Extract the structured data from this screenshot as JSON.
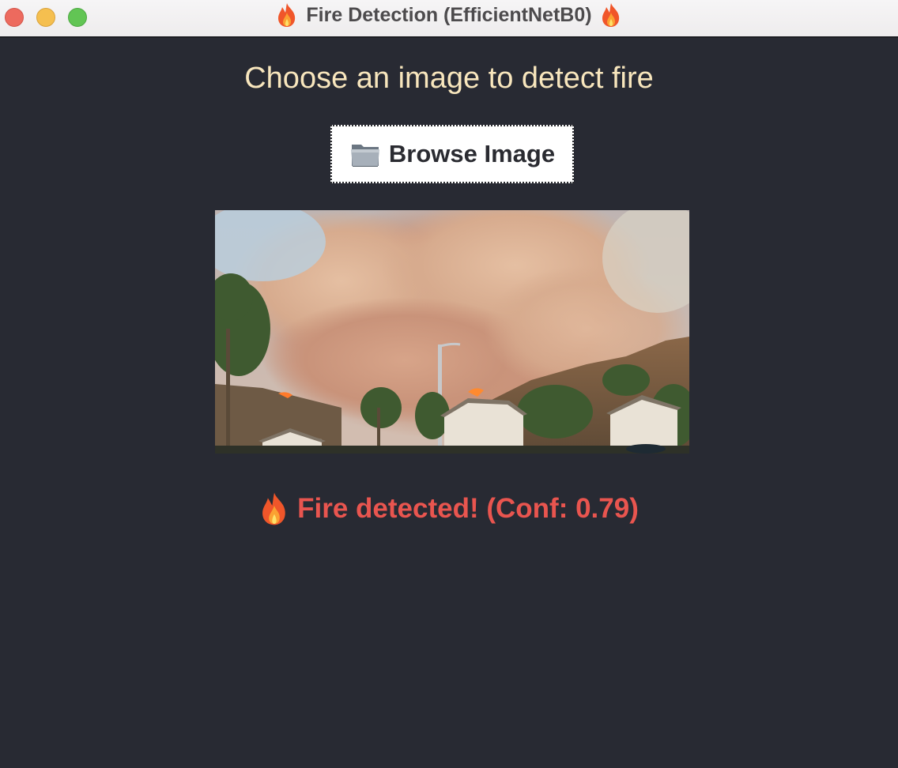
{
  "window": {
    "title": "Fire Detection (EfficientNetB0)",
    "title_icons": [
      "fire-icon",
      "fire-icon"
    ]
  },
  "main": {
    "heading": "Choose an image to detect fire",
    "browse_button": {
      "icon": "folder-icon",
      "label": "Browse Image"
    },
    "preview_image": "wildfire smoke over suburban neighborhood",
    "result": {
      "icon": "fire-icon",
      "text": "Fire detected! (Conf: 0.79)",
      "confidence": 0.79
    }
  },
  "colors": {
    "background": "#282a33",
    "heading": "#f8e6bd",
    "result": "#e9554f",
    "button_bg": "#ffffff"
  }
}
